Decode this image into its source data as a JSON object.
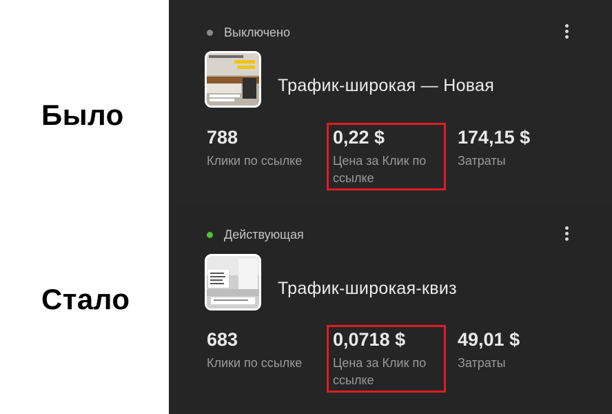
{
  "comparison": {
    "before_label": "Было",
    "after_label": "Стало"
  },
  "colors": {
    "highlight": "#e11b22",
    "status_off": "#8a8a8a",
    "status_active": "#4cc72d",
    "panel_bg": "#262626"
  },
  "campaigns": [
    {
      "status": "Выключено",
      "name": "Трафик-широкая — Новая",
      "menu_icon": "kebab-menu-icon",
      "metrics": [
        {
          "value": "788",
          "label": "Клики по ссылке"
        },
        {
          "value": "0,22 $",
          "label": "Цена за Клик по ссылке"
        },
        {
          "value": "174,15 $",
          "label": "Затраты"
        }
      ]
    },
    {
      "status": "Действующая",
      "name": "Трафик-широкая-квиз",
      "menu_icon": "kebab-menu-icon",
      "metrics": [
        {
          "value": "683",
          "label": "Клики по ссылке"
        },
        {
          "value": "0,0718 $",
          "label": "Цена за Клик по ссылке"
        },
        {
          "value": "49,01 $",
          "label": "Затраты"
        }
      ]
    }
  ]
}
